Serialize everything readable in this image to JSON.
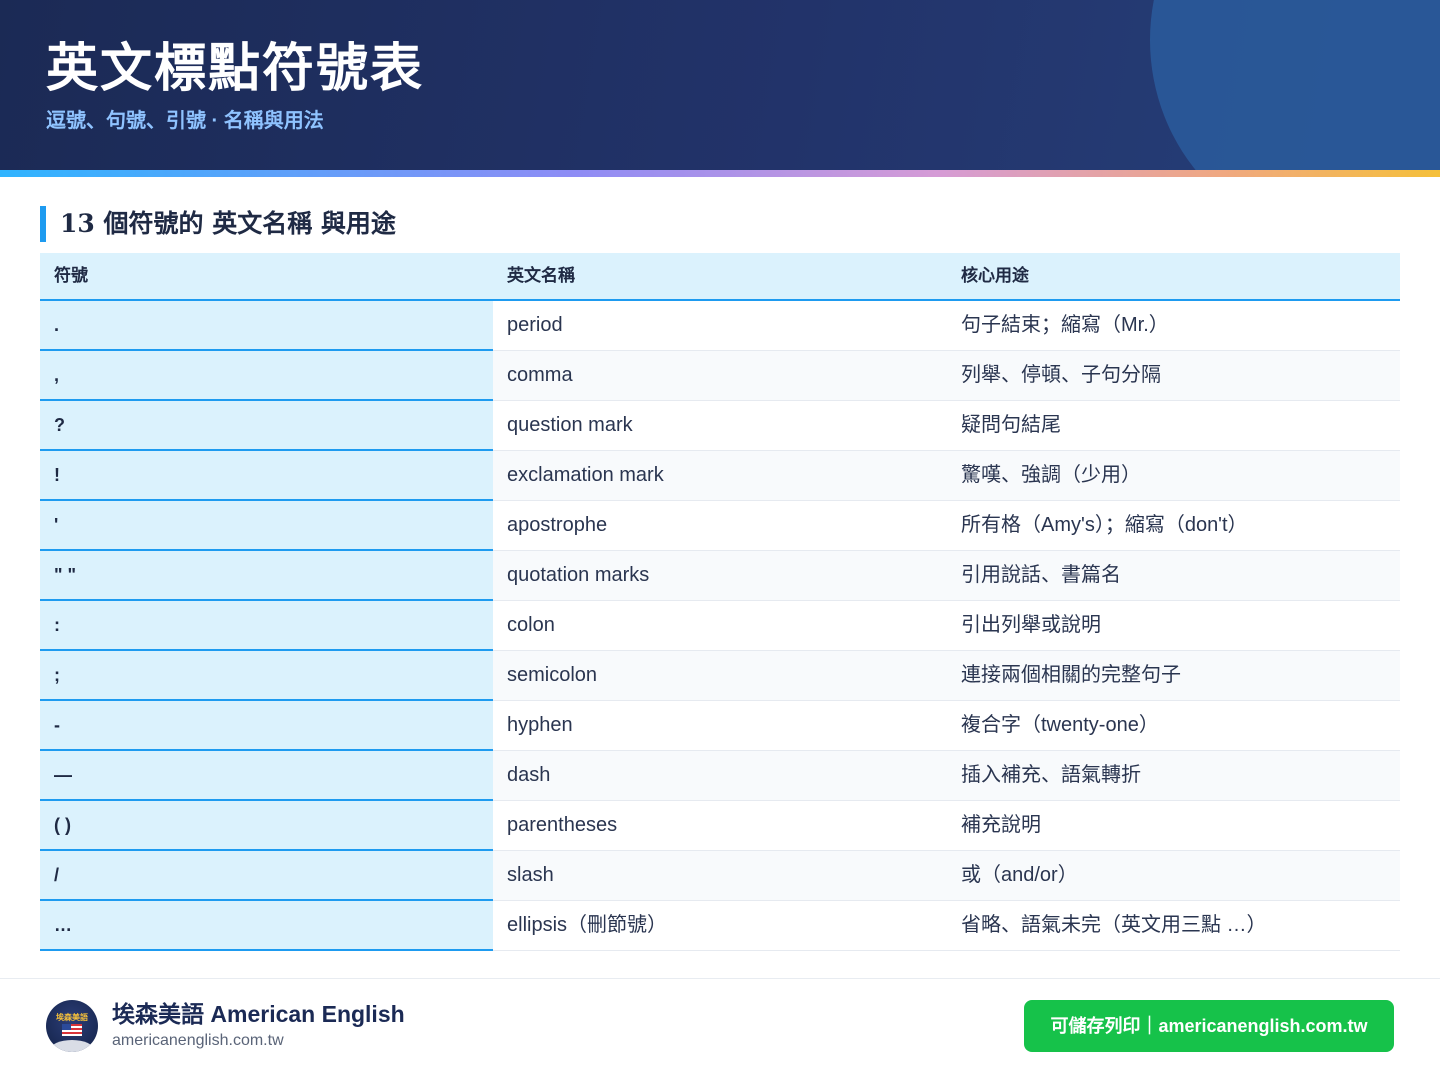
{
  "header": {
    "title": "英文標點符號表",
    "subtitle": "逗號、句號、引號 · 名稱與用法"
  },
  "section": {
    "title": "13 個符號的 英文名稱 與用途"
  },
  "table": {
    "columns": [
      "符號",
      "英文名稱",
      "核心用途"
    ],
    "rows": [
      {
        "symbol": ".",
        "name": "period",
        "use": "句子結束；縮寫（Mr.）"
      },
      {
        "symbol": ",",
        "name": "comma",
        "use": "列舉、停頓、子句分隔"
      },
      {
        "symbol": "?",
        "name": "question mark",
        "use": "疑問句結尾"
      },
      {
        "symbol": "!",
        "name": "exclamation mark",
        "use": "驚嘆、強調（少用）"
      },
      {
        "symbol": "'",
        "name": "apostrophe",
        "use": "所有格（Amy's）；縮寫（don't）"
      },
      {
        "symbol": "\" \"",
        "name": "quotation marks",
        "use": "引用說話、書篇名"
      },
      {
        "symbol": ":",
        "name": "colon",
        "use": "引出列舉或說明"
      },
      {
        "symbol": ";",
        "name": "semicolon",
        "use": "連接兩個相關的完整句子"
      },
      {
        "symbol": "-",
        "name": "hyphen",
        "use": "複合字（twenty-one）"
      },
      {
        "symbol": "—",
        "name": "dash",
        "use": "插入補充、語氣轉折"
      },
      {
        "symbol": "( )",
        "name": "parentheses",
        "use": "補充說明"
      },
      {
        "symbol": "/",
        "name": "slash",
        "use": "或（and/or）"
      },
      {
        "symbol": "…",
        "name": "ellipsis（刪節號）",
        "use": "省略、語氣未完（英文用三點 …）"
      }
    ]
  },
  "footer": {
    "brand_name": "埃森美語 American English",
    "brand_url": "americanenglish.com.tw",
    "logo_text": "埃森美語",
    "print_button": "可儲存列印｜americanenglish.com.tw"
  },
  "colors": {
    "header_bg": "#1b2a55",
    "accent": "#1e9bf0",
    "symbol_cell_bg": "#dbf2fd",
    "button_green": "#16c24a"
  }
}
